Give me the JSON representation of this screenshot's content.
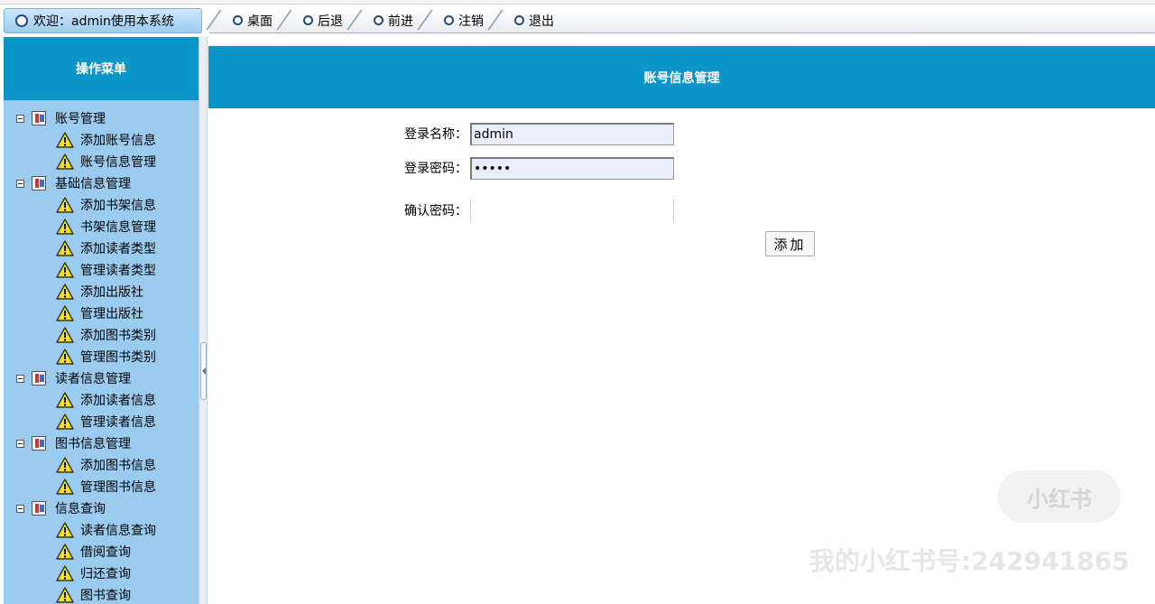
{
  "header": {
    "welcome_text": "欢迎：admin使用本系统",
    "nav": [
      {
        "label": "桌面",
        "icon": "circle-icon"
      },
      {
        "label": "后退",
        "icon": "circle-icon"
      },
      {
        "label": "前进",
        "icon": "circle-icon"
      },
      {
        "label": "注销",
        "icon": "circle-icon"
      },
      {
        "label": "退出",
        "icon": "circle-icon"
      }
    ]
  },
  "sidebar": {
    "title": "操作菜单",
    "groups": [
      {
        "label": "账号管理",
        "items": [
          "添加账号信息",
          "账号信息管理"
        ]
      },
      {
        "label": "基础信息管理",
        "items": [
          "添加书架信息",
          "书架信息管理",
          "添加读者类型",
          "管理读者类型",
          "添加出版社",
          "管理出版社",
          "添加图书类别",
          "管理图书类别"
        ]
      },
      {
        "label": "读者信息管理",
        "items": [
          "添加读者信息",
          "管理读者信息"
        ]
      },
      {
        "label": "图书信息管理",
        "items": [
          "添加图书信息",
          "管理图书信息"
        ]
      },
      {
        "label": "信息查询",
        "items": [
          "读者信息查询",
          "借阅查询",
          "归还查询",
          "图书查询"
        ]
      }
    ]
  },
  "main": {
    "title": "账号信息管理",
    "form": {
      "username_label": "登录名称：",
      "username_value": "admin",
      "password_label": "登录密码：",
      "password_value": "•••••",
      "confirm_label": "确认密码：",
      "confirm_value": "",
      "submit_label": "添加"
    }
  },
  "watermark": {
    "badge": "小红书",
    "text": "我的小红书号:242941865"
  },
  "colors": {
    "header_blue": "#0a96c8",
    "sidebar_bg": "#9ccbf0",
    "input_bg": "#e8effa"
  }
}
